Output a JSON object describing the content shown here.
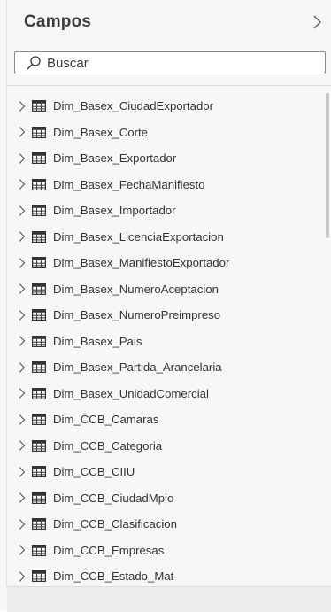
{
  "panel": {
    "title": "Campos"
  },
  "search": {
    "placeholder": "Buscar"
  },
  "fields": [
    {
      "label": "Dim_Basex_CiudadExportador"
    },
    {
      "label": "Dim_Basex_Corte"
    },
    {
      "label": "Dim_Basex_Exportador"
    },
    {
      "label": "Dim_Basex_FechaManifiesto"
    },
    {
      "label": "Dim_Basex_Importador"
    },
    {
      "label": "Dim_Basex_LicenciaExportacion"
    },
    {
      "label": "Dim_Basex_ManifiestoExportador"
    },
    {
      "label": "Dim_Basex_NumeroAceptacion"
    },
    {
      "label": "Dim_Basex_NumeroPreimpreso"
    },
    {
      "label": "Dim_Basex_Pais"
    },
    {
      "label": "Dim_Basex_Partida_Arancelaria"
    },
    {
      "label": "Dim_Basex_UnidadComercial"
    },
    {
      "label": "Dim_CCB_Camaras"
    },
    {
      "label": "Dim_CCB_Categoria"
    },
    {
      "label": "Dim_CCB_CIIU"
    },
    {
      "label": "Dim_CCB_CiudadMpio"
    },
    {
      "label": "Dim_CCB_Clasificacion"
    },
    {
      "label": "Dim_CCB_Empresas"
    },
    {
      "label": "Dim_CCB_Estado_Mat"
    }
  ],
  "icons": {
    "collapse": "chevron-right-icon",
    "search": "search-icon",
    "expand": "chevron-right-icon",
    "table": "table-icon"
  },
  "colors": {
    "panel_bg": "#f7f7f7",
    "text": "#333333",
    "title": "#3b3b3b"
  }
}
